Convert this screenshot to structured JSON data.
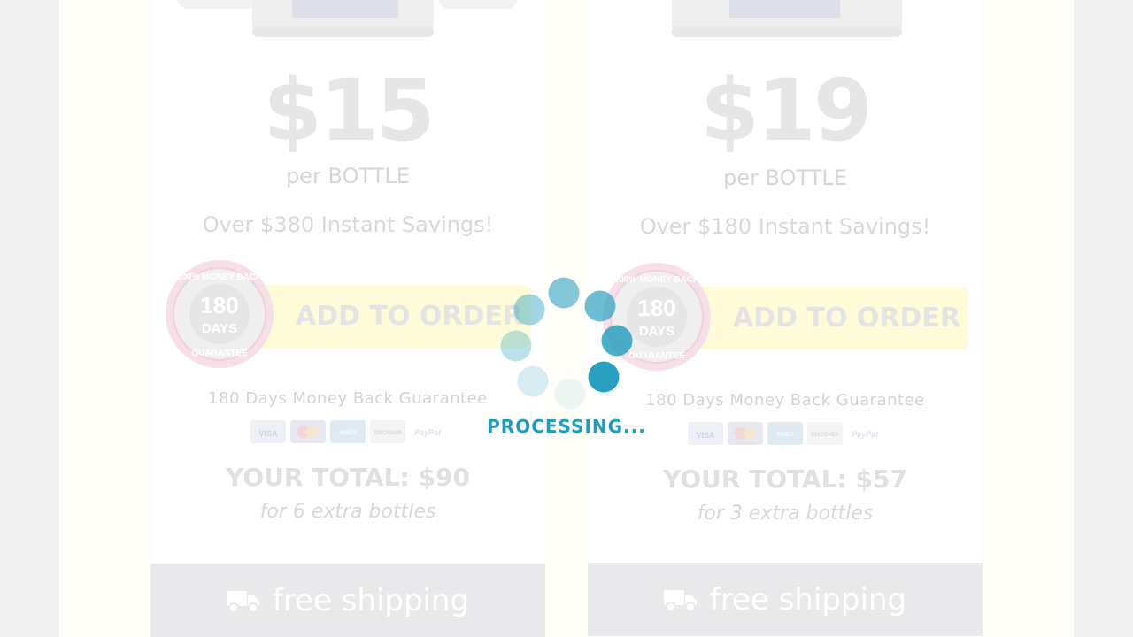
{
  "offers": [
    {
      "price": "$15",
      "per_unit": "per BOTTLE",
      "savings": "Over $380 Instant Savings!",
      "add_button": "ADD TO ORDER",
      "badge": {
        "top_text": "100% MONEY BACK",
        "days": "180",
        "days_label": "DAYS",
        "bottom_text": "GUARANTEE"
      },
      "guarantee_text": "180 Days Money Back Guarantee",
      "payment_methods": [
        "VISA",
        "MasterCard",
        "AMEX",
        "DISCOVER",
        "PayPal"
      ],
      "total": "YOUR TOTAL: $90",
      "extra": "for 6 extra bottles",
      "shipping": "free shipping"
    },
    {
      "price": "$19",
      "per_unit": "per BOTTLE",
      "savings": "Over $180 Instant Savings!",
      "add_button": "ADD TO ORDER",
      "badge": {
        "top_text": "100% MONEY BACK",
        "days": "180",
        "days_label": "DAYS",
        "bottom_text": "GUARANTEE"
      },
      "guarantee_text": "180 Days Money Back Guarantee",
      "payment_methods": [
        "VISA",
        "MasterCard",
        "AMEX",
        "DISCOVER",
        "PayPal"
      ],
      "total": "YOUR TOTAL: $57",
      "extra": "for 3 extra bottles",
      "shipping": "free shipping"
    }
  ],
  "overlay": {
    "status": "PROCESSING...",
    "spinner_color": "#1f9bbd"
  },
  "icons": {
    "shipping": "truck-icon",
    "spinner": "loading-spinner-icon",
    "badge": "money-back-seal-icon"
  }
}
